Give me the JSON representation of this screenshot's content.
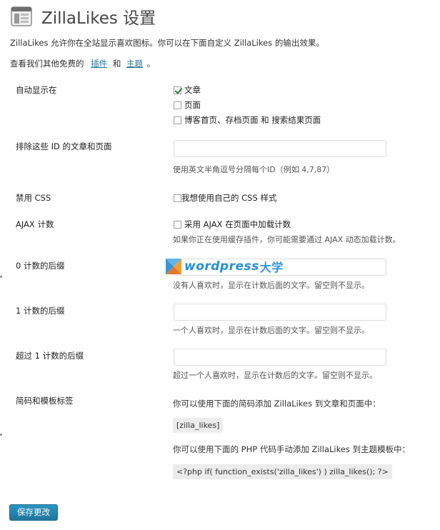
{
  "page": {
    "title": "ZillaLikes 设置",
    "intro_line1": "ZillaLikes 允许你在全站显示喜欢图标。你可以在下面自定义 ZillaLikes 的输出效果。",
    "intro_line2_prefix": "查看我们其他免费的",
    "plugins_link": "插件",
    "and_text": "和",
    "themes_link": "主题",
    "period": "。"
  },
  "settings": {
    "auto_display": {
      "label": "自动显示在",
      "options": [
        {
          "label": "文章",
          "checked": true
        },
        {
          "label": "页面",
          "checked": false
        },
        {
          "label": "博客首页、存档页面 和 搜索结果页面",
          "checked": false
        }
      ]
    },
    "exclude_ids": {
      "label": "排除这些 ID 的文章和页面",
      "value": "",
      "description": "使用英文半角逗号分隔每个ID（例如 4,7,87）"
    },
    "disable_css": {
      "label": "禁用 CSS",
      "checkbox_label": "我想使用自己的 CSS 样式",
      "checked": false
    },
    "ajax_count": {
      "label": "AJAX 计数",
      "checkbox_label": "采用 AJAX 在页面中加载计数",
      "checked": false,
      "description": "如果你正在使用缓存插件，你可能需要通过 AJAX 动态加载计数。"
    },
    "zero_postfix": {
      "label": "0 计数的后缀",
      "value": "",
      "description": "没有人喜欢时，显示在计数后面的文字。留空则不显示。"
    },
    "one_postfix": {
      "label": "1 计数的后缀",
      "value": "",
      "description": "一个人喜欢时，显示在计数后面的文字。留空则不显示。"
    },
    "more_postfix": {
      "label": "超过 1 计数的后缀",
      "value": "",
      "description": "超过一个人喜欢时，显示在计数后的文字。留空则不显示。"
    },
    "shortcode": {
      "label": "简码和模板标签",
      "shortcode_intro": "你可以使用下面的简码添加 ZillaLikes 到文章和页面中：",
      "shortcode": "[zilla_likes]",
      "php_intro": "你可以使用下面的 PHP 代码手动添加 ZillaLikes 到主题模板中：",
      "php_code": "<?php if( function_exists('zilla_likes') ) zilla_likes(); ?>"
    }
  },
  "save_button": "保存更改",
  "watermark": {
    "text": "wordpress",
    "cn": "大学"
  }
}
